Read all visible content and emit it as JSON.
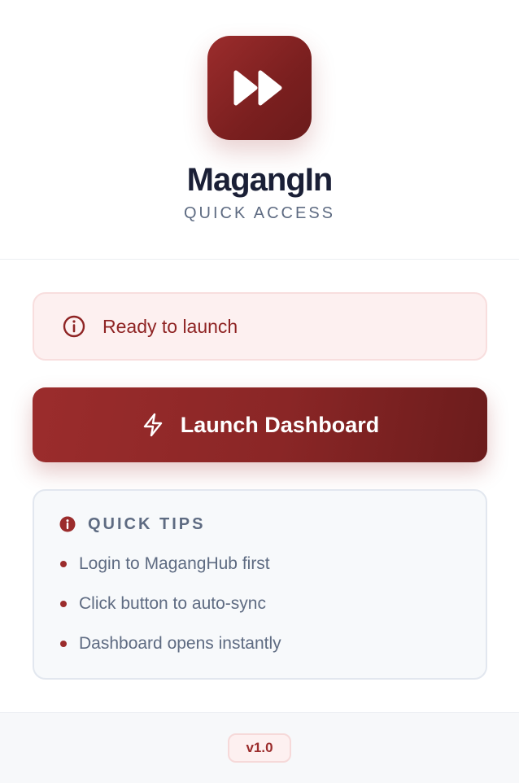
{
  "app": {
    "title": "MagangIn",
    "subtitle": "QUICK ACCESS",
    "logo_icon": "fast-forward-icon"
  },
  "status": {
    "icon": "info-circle-icon",
    "text": "Ready to launch"
  },
  "launch_button": {
    "icon": "lightning-bolt-icon",
    "label": "Launch Dashboard"
  },
  "tips": {
    "icon": "info-filled-icon",
    "title": "QUICK TIPS",
    "items": [
      "Login to MagangHub first",
      "Click button to auto-sync",
      "Dashboard opens instantly"
    ]
  },
  "footer": {
    "version": "v1.0"
  },
  "colors": {
    "accent": "#9b2c2c",
    "accent_dark": "#6b1b1b",
    "status_bg": "#fdf0f0",
    "tips_bg": "#f7f9fb",
    "title_text": "#1a1f36",
    "muted_text": "#5e6b82"
  }
}
